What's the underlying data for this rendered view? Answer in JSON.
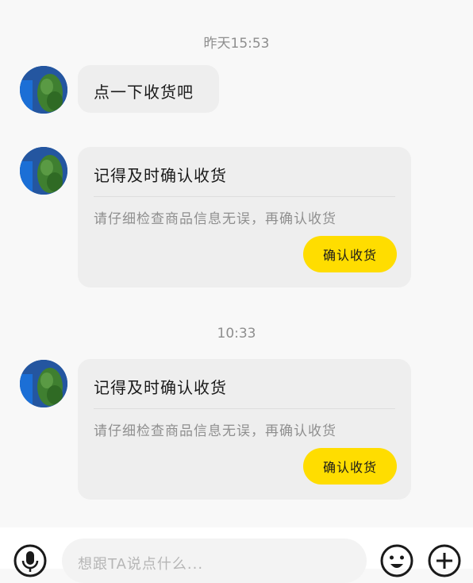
{
  "messages": [
    {
      "type": "timestamp",
      "text": "昨天15:53"
    },
    {
      "type": "text",
      "sender": "seller",
      "text": "点一下收货吧"
    },
    {
      "type": "card",
      "sender": "seller",
      "title": "记得及时确认收货",
      "description": "请仔细检查商品信息无误，再确认收货",
      "button": "确认收货"
    },
    {
      "type": "timestamp",
      "text": "10:33"
    },
    {
      "type": "card",
      "sender": "seller",
      "title": "记得及时确认收货",
      "description": "请仔细检查商品信息无误，再确认收货",
      "button": "确认收货"
    }
  ],
  "input_bar": {
    "voice_icon": "microphone-icon",
    "placeholder": "想跟TA说点什么...",
    "emoji_icon": "emoji-icon",
    "plus_icon": "plus-icon"
  },
  "colors": {
    "accent": "#ffdd00",
    "bubble": "#eeeeee",
    "background": "#f8f8f8"
  }
}
